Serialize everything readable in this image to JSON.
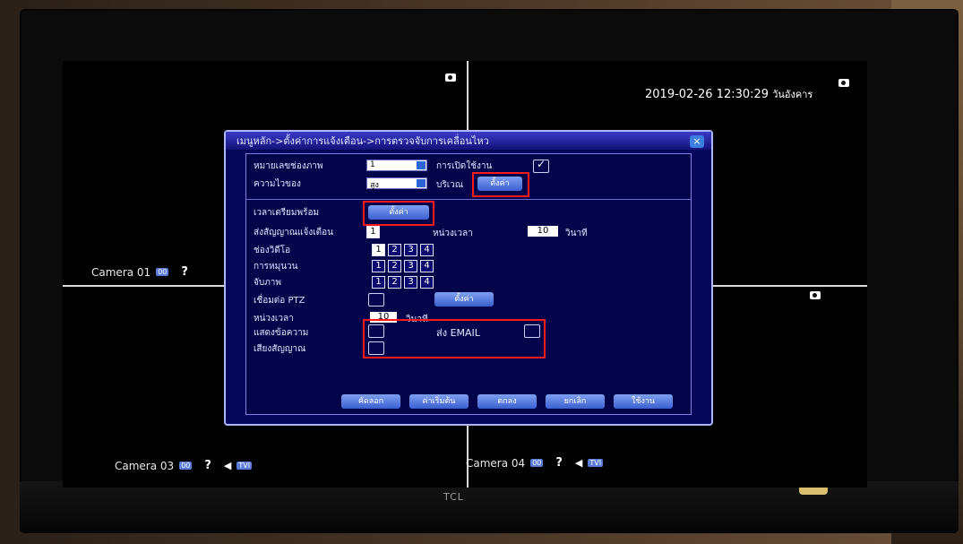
{
  "screen": {
    "datetime": "2019-02-26 12:30:29",
    "weekday": "วันอังคาร",
    "cameras": [
      {
        "label": "Camera 01"
      },
      {
        "label": "Camera 03"
      },
      {
        "label": "Camera 04"
      }
    ],
    "badge_text": "00",
    "tvi_text": "TVI",
    "question_mark": "?"
  },
  "tv": {
    "brand": "TCL"
  },
  "dialog": {
    "title": "เมนูหลัก->ตั้งค่าการแจ้งเตือน->การตรวจจับการเคลื่อนไหว",
    "close_symbol": "×",
    "channel_label": "หมายเลขช่องภาพ",
    "channel_value": "1",
    "enable_label": "การเปิดใช้งาน",
    "sensitivity_label": "ความไวของ",
    "sensitivity_value": "สูง",
    "region_label": "บริเวณ",
    "region_button": "ตั้งค่า",
    "schedule_label": "เวลาเตรียมพร้อม",
    "schedule_button": "ตั้งค่า",
    "alarm_out_label": "ส่งสัญญาณแจ้งเตือน",
    "alarm_out_value": "1",
    "interval_label": "หน่วงเวลา",
    "interval_value": "10",
    "seconds_label": "วินาที",
    "record_label": "ช่องวิดีโอ",
    "tour_label": "การหมุนวน",
    "snapshot_label": "จับภาพ",
    "channel_numbers": [
      "1",
      "2",
      "3",
      "4"
    ],
    "ptz_label": "เชื่อมต่อ PTZ",
    "ptz_button": "ตั้งค่า",
    "delay_label": "หน่วงเวลา",
    "delay_value": "10",
    "delay_unit": "วินาที",
    "show_message_label": "แสดงข้อความ",
    "send_email_label": "ส่ง EMAIL",
    "buzzer_label": "เสียงสัญญาณ",
    "footer_buttons": [
      "คัดลอก",
      "ค่าเริ่มต้น",
      "ตกลง",
      "ยกเลิก",
      "ใช้งาน"
    ]
  }
}
